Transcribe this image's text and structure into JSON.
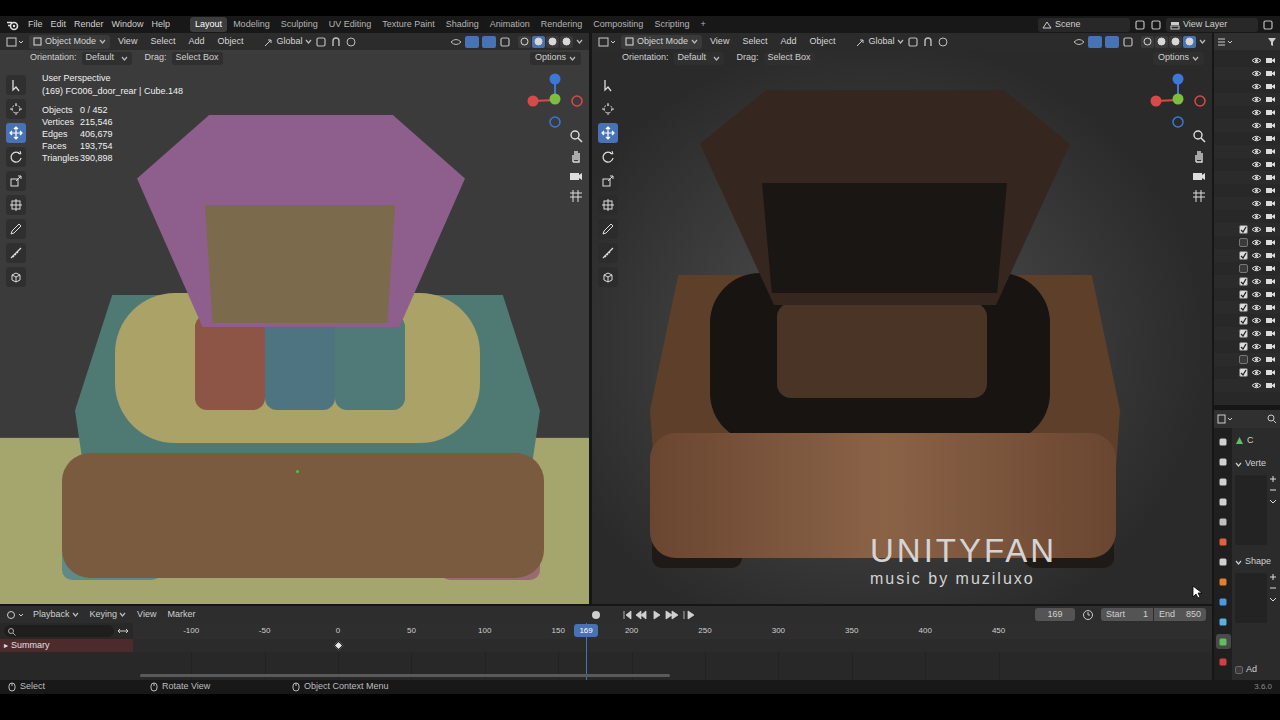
{
  "topbar": {
    "menus": [
      "File",
      "Edit",
      "Render",
      "Window",
      "Help"
    ],
    "workspaces": [
      {
        "label": "Layout",
        "selected": true
      },
      {
        "label": "Modeling",
        "selected": false
      },
      {
        "label": "Sculpting",
        "selected": false
      },
      {
        "label": "UV Editing",
        "selected": false
      },
      {
        "label": "Texture Paint",
        "selected": false
      },
      {
        "label": "Shading",
        "selected": false
      },
      {
        "label": "Animation",
        "selected": false
      },
      {
        "label": "Rendering",
        "selected": false
      },
      {
        "label": "Compositing",
        "selected": false
      },
      {
        "label": "Scripting",
        "selected": false
      }
    ],
    "add_tab": "+",
    "scene": "Scene",
    "view_layer": "View Layer"
  },
  "viewports": [
    {
      "kind": "solid",
      "mode": "Object Mode",
      "menus": [
        "View",
        "Select",
        "Add",
        "Object"
      ],
      "transform": "Global",
      "orientation_label": "Orientation:",
      "orientation": "Default",
      "drag_label": "Drag:",
      "drag": "Select Box",
      "options": "Options",
      "shading_modes": [
        {
          "selected": false
        },
        {
          "selected": true
        },
        {
          "selected": false
        },
        {
          "selected": false
        }
      ],
      "tools": [
        {
          "selected": false
        },
        {
          "selected": false
        },
        {
          "selected": true
        },
        {
          "selected": false
        },
        {
          "selected": false
        },
        {
          "selected": false
        },
        {
          "selected": false
        },
        {
          "selected": false
        },
        {
          "selected": false
        }
      ],
      "overlay": {
        "view_name": "User Perspective",
        "object_info": "(169) FC006_door_rear | Cube.148",
        "stats": [
          {
            "label": "Objects",
            "value": "0 / 452"
          },
          {
            "label": "Vertices",
            "value": "215,546"
          },
          {
            "label": "Edges",
            "value": "406,679"
          },
          {
            "label": "Faces",
            "value": "193,754"
          },
          {
            "label": "Triangles",
            "value": "390,898"
          }
        ]
      }
    },
    {
      "kind": "rendered",
      "mode": "Object Mode",
      "menus": [
        "View",
        "Select",
        "Add",
        "Object"
      ],
      "transform": "Global",
      "orientation_label": "Orientation:",
      "orientation": "Default",
      "drag_label": "Drag:",
      "drag": "Select Box",
      "options": "Options",
      "shading_modes": [
        {
          "selected": false
        },
        {
          "selected": false
        },
        {
          "selected": false
        },
        {
          "selected": true
        }
      ],
      "tools": [
        {
          "selected": false
        },
        {
          "selected": false
        },
        {
          "selected": true
        },
        {
          "selected": false
        },
        {
          "selected": false
        },
        {
          "selected": false
        },
        {
          "selected": false
        },
        {
          "selected": false
        },
        {
          "selected": false
        }
      ]
    }
  ],
  "watermark": {
    "title": "UNITYFAN",
    "subtitle": "music by muziluxo"
  },
  "outliner": {
    "rows": [
      {
        "kind": "plain"
      },
      {
        "kind": "plain"
      },
      {
        "kind": "plain"
      },
      {
        "kind": "plain"
      },
      {
        "kind": "plain"
      },
      {
        "kind": "plain"
      },
      {
        "kind": "plain"
      },
      {
        "kind": "plain"
      },
      {
        "kind": "plain"
      },
      {
        "kind": "plain"
      },
      {
        "kind": "plain"
      },
      {
        "kind": "plain"
      },
      {
        "kind": "plain"
      },
      {
        "kind": "check",
        "checked": true
      },
      {
        "kind": "check",
        "checked": false
      },
      {
        "kind": "check",
        "checked": true
      },
      {
        "kind": "check",
        "checked": false
      },
      {
        "kind": "check",
        "checked": true
      },
      {
        "kind": "check",
        "checked": true
      },
      {
        "kind": "check",
        "checked": true
      },
      {
        "kind": "check",
        "checked": true
      },
      {
        "kind": "check",
        "checked": true
      },
      {
        "kind": "check",
        "checked": true
      },
      {
        "kind": "check",
        "checked": false
      },
      {
        "kind": "check",
        "checked": true
      },
      {
        "kind": "plain"
      }
    ]
  },
  "properties": {
    "tabs": [
      {
        "selected": false
      },
      {
        "selected": false
      },
      {
        "selected": false
      },
      {
        "selected": false
      },
      {
        "selected": false
      },
      {
        "selected": false
      },
      {
        "selected": false
      },
      {
        "selected": false
      },
      {
        "selected": false
      },
      {
        "selected": false
      },
      {
        "selected": true
      },
      {
        "selected": false
      }
    ],
    "object_name": "C",
    "panels": [
      {
        "label": "Verte",
        "expanded": true
      },
      {
        "label": "Shape",
        "expanded": true
      }
    ],
    "footer": "Ad"
  },
  "timeline": {
    "menus": [
      "Playback",
      "Keying",
      "View",
      "Marker"
    ],
    "current_frame": "169",
    "start_label": "Start",
    "start": "1",
    "end_label": "End",
    "end": "850",
    "ticks": [
      "-100",
      "-50",
      "0",
      "50",
      "100",
      "150",
      "200",
      "250",
      "300",
      "350",
      "400",
      "450"
    ],
    "playhead": "169",
    "channel": "Summary",
    "expander": "▸",
    "keyframes": [
      0
    ]
  },
  "status_bar": {
    "items": [
      "Select",
      "Rotate View",
      "Object Context Menu"
    ],
    "version": "3.6.0"
  }
}
